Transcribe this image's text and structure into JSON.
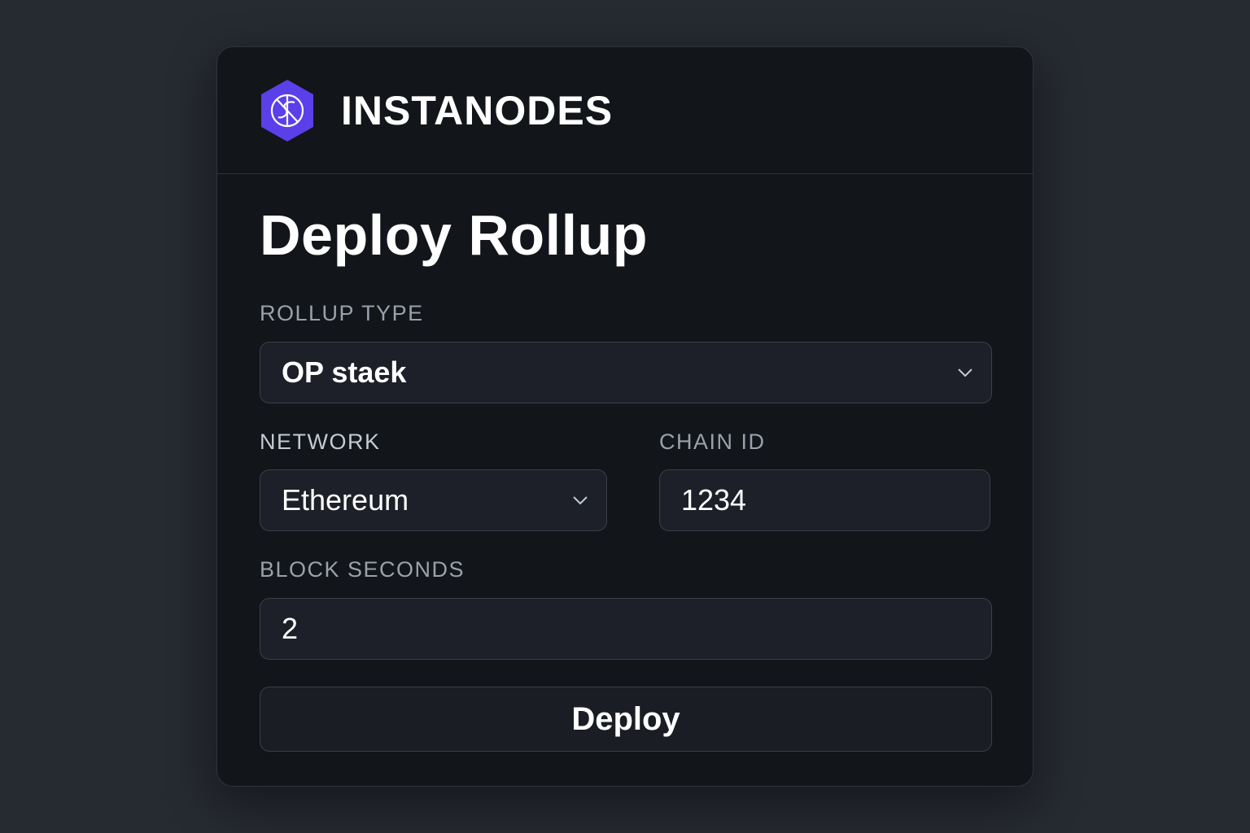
{
  "brand": {
    "name": "INSTANODES",
    "logo_icon": "hexagon-logo-icon",
    "accent": "#5b3fe8"
  },
  "form": {
    "title": "Deploy Rollup",
    "rollup_type": {
      "label": "ROLLUP TYPE",
      "value": "OP staek"
    },
    "network": {
      "label": "NETWORK",
      "value": "Ethereum"
    },
    "chain_id": {
      "label": "CHAIN ID",
      "value": "1234"
    },
    "block_seconds": {
      "label": "BLOCK SECONDS",
      "value": "2"
    },
    "deploy_label": "Deploy"
  }
}
